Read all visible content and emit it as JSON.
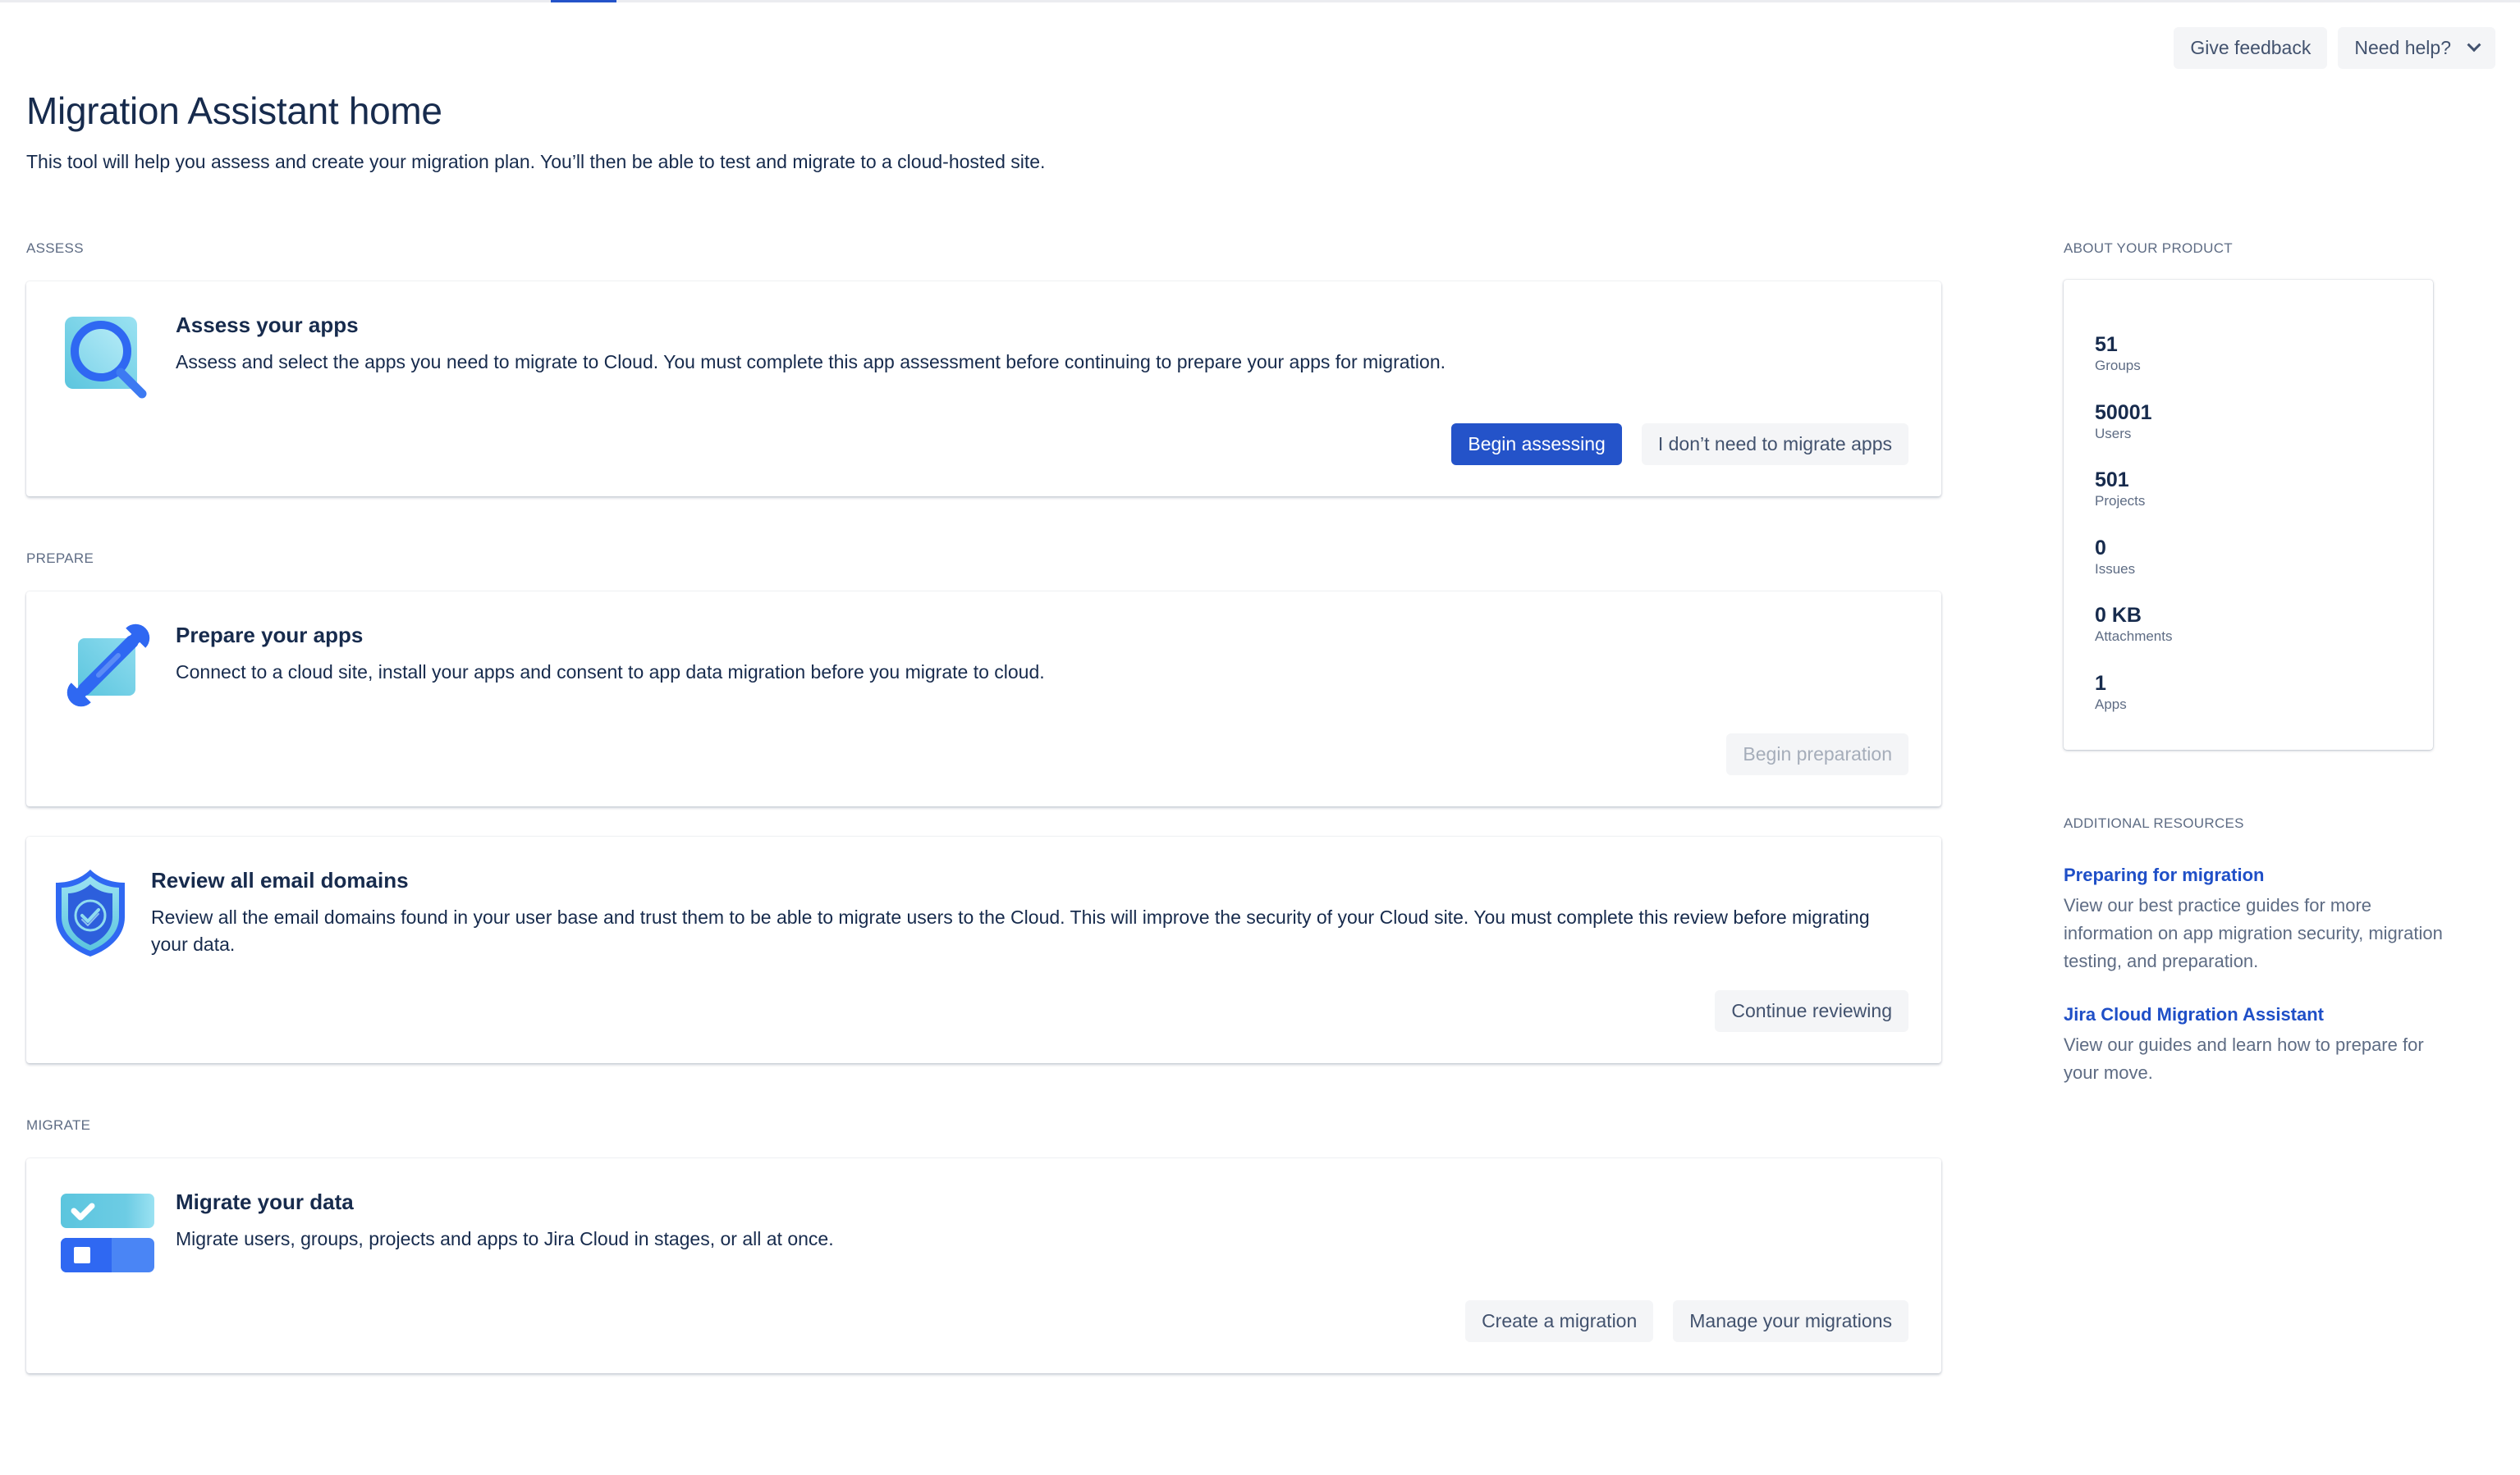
{
  "header": {
    "give_feedback_label": "Give feedback",
    "need_help_label": "Need help?"
  },
  "page": {
    "title": "Migration Assistant home",
    "subtitle": "This tool will help you assess and create your migration plan. You’ll then be able to test and migrate to a cloud-hosted site."
  },
  "sections": {
    "assess": {
      "label": "ASSESS",
      "card": {
        "icon": "magnifier-icon",
        "title": "Assess your apps",
        "description": "Assess and select the apps you need to migrate to Cloud. You must complete this app assessment before continuing to prepare your apps for migration.",
        "primary_button": "Begin assessing",
        "secondary_button": "I don’t need to migrate apps"
      }
    },
    "prepare": {
      "label": "PREPARE",
      "apps_card": {
        "icon": "wrench-icon",
        "title": "Prepare your apps",
        "description": "Connect to a cloud site, install your apps and consent to app data migration before you migrate to cloud.",
        "button": "Begin preparation",
        "button_disabled": true
      },
      "email_card": {
        "icon": "shield-check-icon",
        "title": "Review all email domains",
        "description": "Review all the email domains found in your user base and trust them to be able to migrate users to the Cloud. This will improve the security of your Cloud site. You must complete this review before migrating your data.",
        "button": "Continue reviewing"
      }
    },
    "migrate": {
      "label": "MIGRATE",
      "card": {
        "icon": "migrate-toggle-icon",
        "title": "Migrate your data",
        "description": "Migrate users, groups, projects and apps to Jira Cloud in stages, or all at once.",
        "primary_button": "Create a migration",
        "secondary_button": "Manage your migrations"
      }
    }
  },
  "about": {
    "label": "ABOUT YOUR PRODUCT",
    "stats": [
      {
        "value": "51",
        "label": "Groups"
      },
      {
        "value": "50001",
        "label": "Users"
      },
      {
        "value": "501",
        "label": "Projects"
      },
      {
        "value": "0",
        "label": "Issues"
      },
      {
        "value": "0 KB",
        "label": "Attachments"
      },
      {
        "value": "1",
        "label": "Apps"
      }
    ]
  },
  "resources": {
    "label": "ADDITIONAL RESOURCES",
    "items": [
      {
        "title": "Preparing for migration",
        "description": "View our best practice guides for more information on app migration security, migration testing, and preparation."
      },
      {
        "title": "Jira Cloud Migration Assistant",
        "description": "View our guides and learn how to prepare for your move."
      }
    ]
  },
  "colors": {
    "primary": "#2453c9",
    "link": "#1f4fc7",
    "text": "#172b4d",
    "subtle_text": "#5e6c84",
    "button_bg": "#f4f5f7",
    "disabled_text": "#a5adba"
  }
}
